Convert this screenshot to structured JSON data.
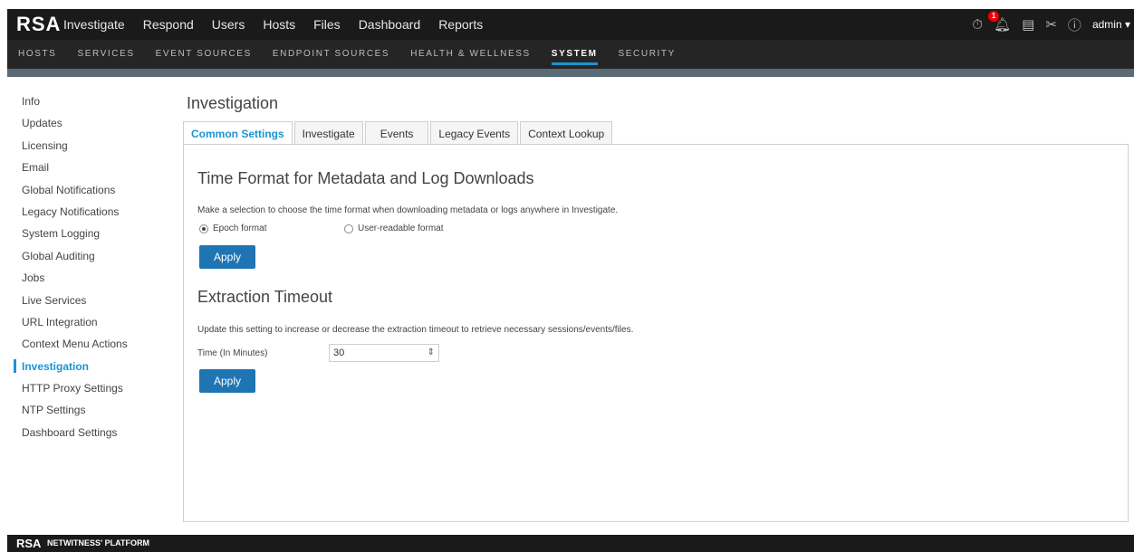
{
  "topbar": {
    "logo": "RSA",
    "nav": [
      "Investigate",
      "Respond",
      "Users",
      "Hosts",
      "Files",
      "Dashboard",
      "Reports"
    ],
    "notification_count": "1",
    "user": "admin"
  },
  "subnav": {
    "items": [
      "HOSTS",
      "SERVICES",
      "EVENT SOURCES",
      "ENDPOINT SOURCES",
      "HEALTH & WELLNESS",
      "SYSTEM",
      "SECURITY"
    ],
    "active": "SYSTEM"
  },
  "sidebar": {
    "items": [
      "Info",
      "Updates",
      "Licensing",
      "Email",
      "Global Notifications",
      "Legacy Notifications",
      "System Logging",
      "Global Auditing",
      "Jobs",
      "Live Services",
      "URL Integration",
      "Context Menu Actions",
      "Investigation",
      "HTTP Proxy Settings",
      "NTP Settings",
      "Dashboard Settings"
    ],
    "active": "Investigation"
  },
  "page": {
    "title": "Investigation",
    "tabs": [
      "Common Settings",
      "Investigate",
      "Events",
      "Legacy Events",
      "Context Lookup"
    ],
    "active_tab": "Common Settings"
  },
  "time_format": {
    "title": "Time Format for Metadata and Log Downloads",
    "description": "Make a selection to choose the time format when downloading metadata or logs anywhere in Investigate.",
    "option_epoch": "Epoch format",
    "option_readable": "User-readable format",
    "selected": "epoch",
    "apply": "Apply"
  },
  "extraction": {
    "title": "Extraction Timeout",
    "description": "Update this setting to increase or decrease the extraction timeout to retrieve necessary sessions/events/files.",
    "label": "Time (In Minutes)",
    "value": "30",
    "apply": "Apply"
  },
  "footer": {
    "logo": "RSA",
    "text": "NETWITNESS' PLATFORM"
  },
  "colors": {
    "accent": "#1c94d2",
    "button": "#1f74b3",
    "topbar": "#1a1a1a"
  }
}
